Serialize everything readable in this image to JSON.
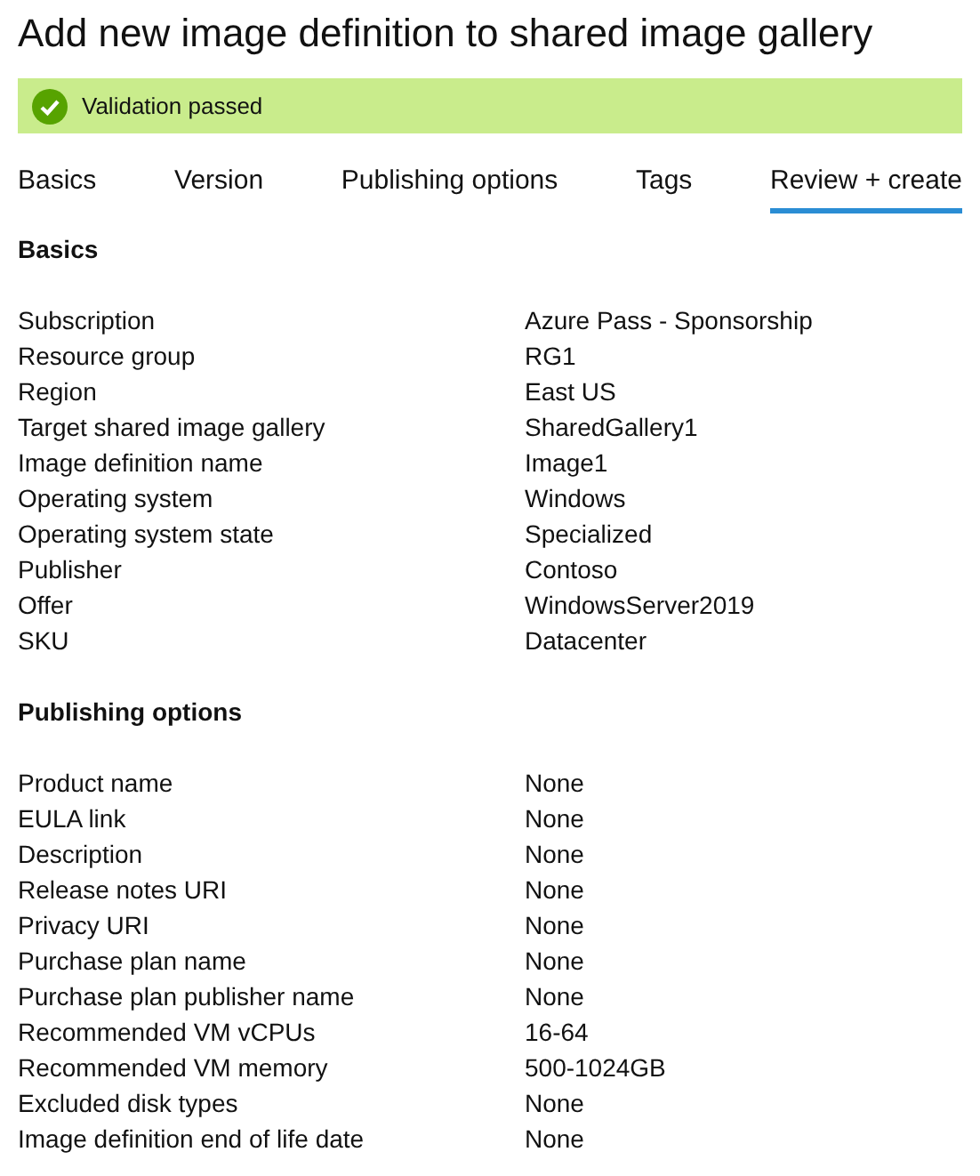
{
  "title": "Add new image definition to shared image gallery",
  "banner": {
    "text": "Validation passed",
    "kind": "success"
  },
  "tabs": [
    {
      "label": "Basics",
      "selected": false
    },
    {
      "label": "Version",
      "selected": false
    },
    {
      "label": "Publishing options",
      "selected": false
    },
    {
      "label": "Tags",
      "selected": false
    },
    {
      "label": "Review + create",
      "selected": true
    }
  ],
  "sections": [
    {
      "heading": "Basics",
      "rows": [
        {
          "label": "Subscription",
          "value": "Azure Pass - Sponsorship"
        },
        {
          "label": "Resource group",
          "value": "RG1"
        },
        {
          "label": "Region",
          "value": "East US"
        },
        {
          "label": "Target shared image gallery",
          "value": "SharedGallery1"
        },
        {
          "label": "Image definition name",
          "value": "Image1"
        },
        {
          "label": "Operating system",
          "value": "Windows"
        },
        {
          "label": "Operating system state",
          "value": "Specialized"
        },
        {
          "label": "Publisher",
          "value": "Contoso"
        },
        {
          "label": "Offer",
          "value": "WindowsServer2019"
        },
        {
          "label": "SKU",
          "value": "Datacenter"
        }
      ]
    },
    {
      "heading": "Publishing options",
      "rows": [
        {
          "label": "Product name",
          "value": "None"
        },
        {
          "label": "EULA link",
          "value": "None"
        },
        {
          "label": "Description",
          "value": "None"
        },
        {
          "label": "Release notes URI",
          "value": "None"
        },
        {
          "label": "Privacy URI",
          "value": "None"
        },
        {
          "label": "Purchase plan name",
          "value": "None"
        },
        {
          "label": "Purchase plan publisher name",
          "value": "None"
        },
        {
          "label": "Recommended VM vCPUs",
          "value": "16-64"
        },
        {
          "label": "Recommended VM memory",
          "value": "500-1024GB"
        },
        {
          "label": "Excluded disk types",
          "value": "None"
        },
        {
          "label": "Image definition end of life date",
          "value": "None"
        }
      ]
    }
  ]
}
